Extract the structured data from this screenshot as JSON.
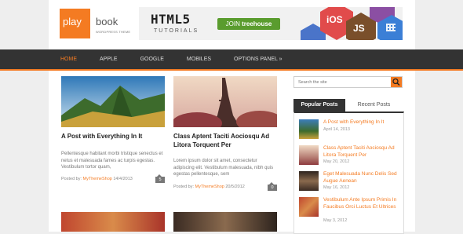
{
  "logo": {
    "word1": "play",
    "word2": "book",
    "tagline": "WORDPRESS THEME"
  },
  "banner": {
    "headline": "HTML5",
    "subline": "TUTORIALS",
    "cta_prefix": "JOIN",
    "cta_brand": "treehouse",
    "badges": [
      "iOS",
      "JS"
    ]
  },
  "nav": {
    "items": [
      "HOME",
      "APPLE",
      "GOOGLE",
      "MOBILES",
      "OPTIONS PANEL »"
    ],
    "active_index": 0
  },
  "posts": [
    {
      "title": "A Post with Everything In It",
      "excerpt": "Pellentesque habitant morbi tristique senectus et netus et malesuada fames ac turpis egestas. Vestibulum tortor quam,",
      "meta_prefix": "Posted by:",
      "author": "MyThemeShop",
      "date": "14/4/2013",
      "comments": "5"
    },
    {
      "title": "Class Aptent Taciti Aociosqu Ad Litora Torquent Per",
      "excerpt": "Lorem ipsum dolor sit amet, consectetur adipiscing elit. Vestibulum malesuada, nibh quis egestas pellentesque, sem",
      "meta_prefix": "Posted by:",
      "author": "MyThemeShop",
      "date": "20/5/2012",
      "comments": "0"
    }
  ],
  "search": {
    "placeholder": "Search the site"
  },
  "sidebar_tabs": [
    "Popular Posts",
    "Recent Posts"
  ],
  "popular_posts": [
    {
      "title": "A Post with Everything In It",
      "date": "April 14, 2013"
    },
    {
      "title": "Class Aptent Taciti Aociosqu Ad Litora Torquent Per",
      "date": "May 20, 2012"
    },
    {
      "title": "Eget Malesuada Nunc Delis Sed Augue Aenean",
      "date": "May 16, 2012"
    },
    {
      "title": "Vestibulum Ante Ipsum Primis In Faucibus Orci Luctus Et Ultrices",
      "date": "May 3, 2012"
    }
  ],
  "colors": {
    "accent": "#f47b22",
    "nav_bg": "#333333",
    "page_bg": "#eeeeee"
  }
}
